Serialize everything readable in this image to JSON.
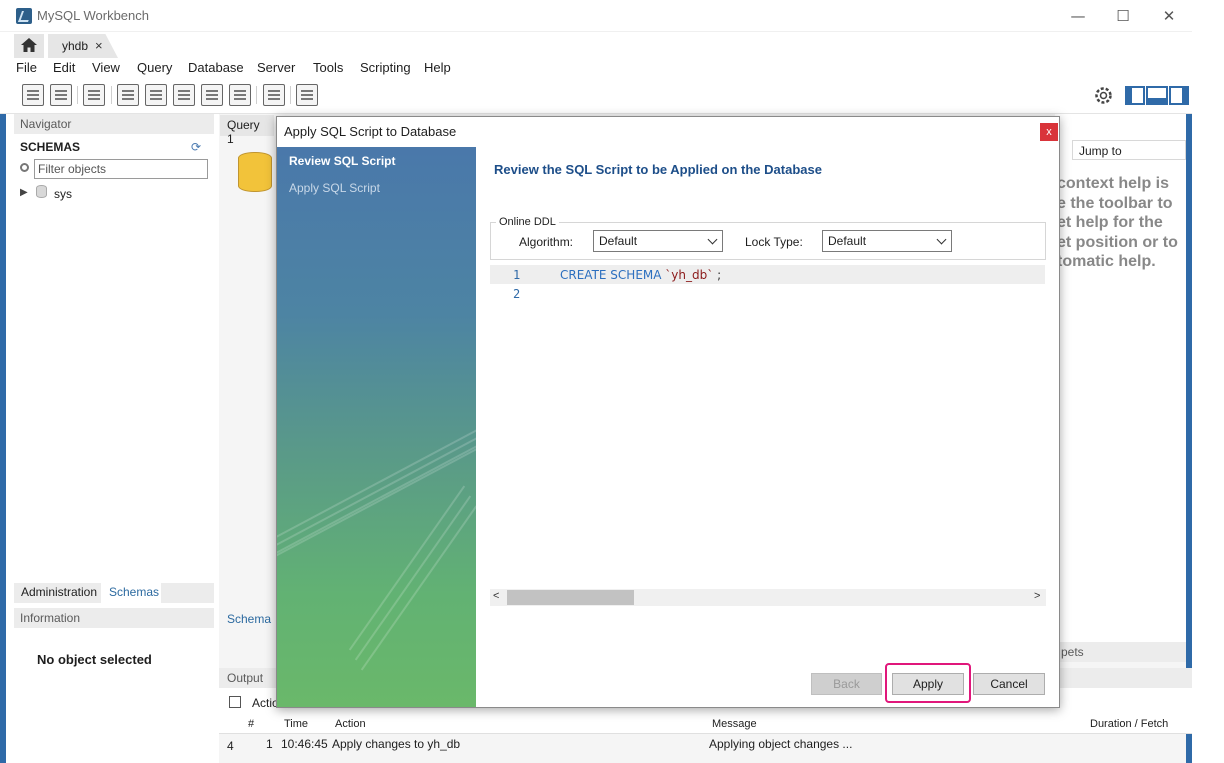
{
  "window": {
    "title": "MySQL Workbench",
    "minimize": "—",
    "maximize": "☐",
    "close": "✕"
  },
  "tabs": {
    "home_icon": "home-icon",
    "connection_tab": "yhdb",
    "close": "×"
  },
  "menu": [
    "File",
    "Edit",
    "View",
    "Query",
    "Database",
    "Server",
    "Tools",
    "Scripting",
    "Help"
  ],
  "navigator": {
    "header": "Navigator",
    "schemas_title": "SCHEMAS",
    "filter_placeholder": "Filter objects",
    "tree": [
      {
        "label": "sys"
      }
    ],
    "bottom_tabs": [
      "Administration",
      "Schemas"
    ],
    "info_header": "Information",
    "no_object": "No object selected"
  },
  "editor": {
    "query_tab": "Query 1",
    "schema_label": "Schema"
  },
  "help_panel": {
    "jump_to": "Jump to",
    "text": "context help is\ne the toolbar to\net help for the\net position or to\ntomatic help.",
    "snippets": "pets"
  },
  "output": {
    "header": "Output",
    "action_label": "Actio",
    "columns": [
      "#",
      "Time",
      "Action",
      "Message",
      "Duration / Fetch"
    ],
    "row": {
      "icon_num": "4",
      "num": "1",
      "time": "10:46:45",
      "action": "Apply changes to yh_db",
      "message": "Applying object changes ..."
    }
  },
  "dialog": {
    "title": "Apply SQL Script to Database",
    "close": "x",
    "steps": [
      "Review SQL Script",
      "Apply SQL Script"
    ],
    "heading": "Review the SQL Script to be Applied on the Database",
    "online_ddl": "Online DDL",
    "algorithm_label": "Algorithm:",
    "algorithm_value": "Default",
    "lock_type_label": "Lock Type:",
    "lock_type_value": "Default",
    "line_numbers": [
      "1",
      "2"
    ],
    "code": {
      "keyword": "CREATE SCHEMA",
      "identifier": "`yh_db`",
      "terminator": " ;"
    },
    "buttons": {
      "back": "Back",
      "apply": "Apply",
      "cancel": "Cancel"
    },
    "scroll_left": "<",
    "scroll_right": ">"
  },
  "colors": {
    "accent_blue": "#2f6aa8",
    "heading_blue": "#1d4e89",
    "highlight_pink": "#e0177b",
    "close_red": "#d9343a"
  }
}
